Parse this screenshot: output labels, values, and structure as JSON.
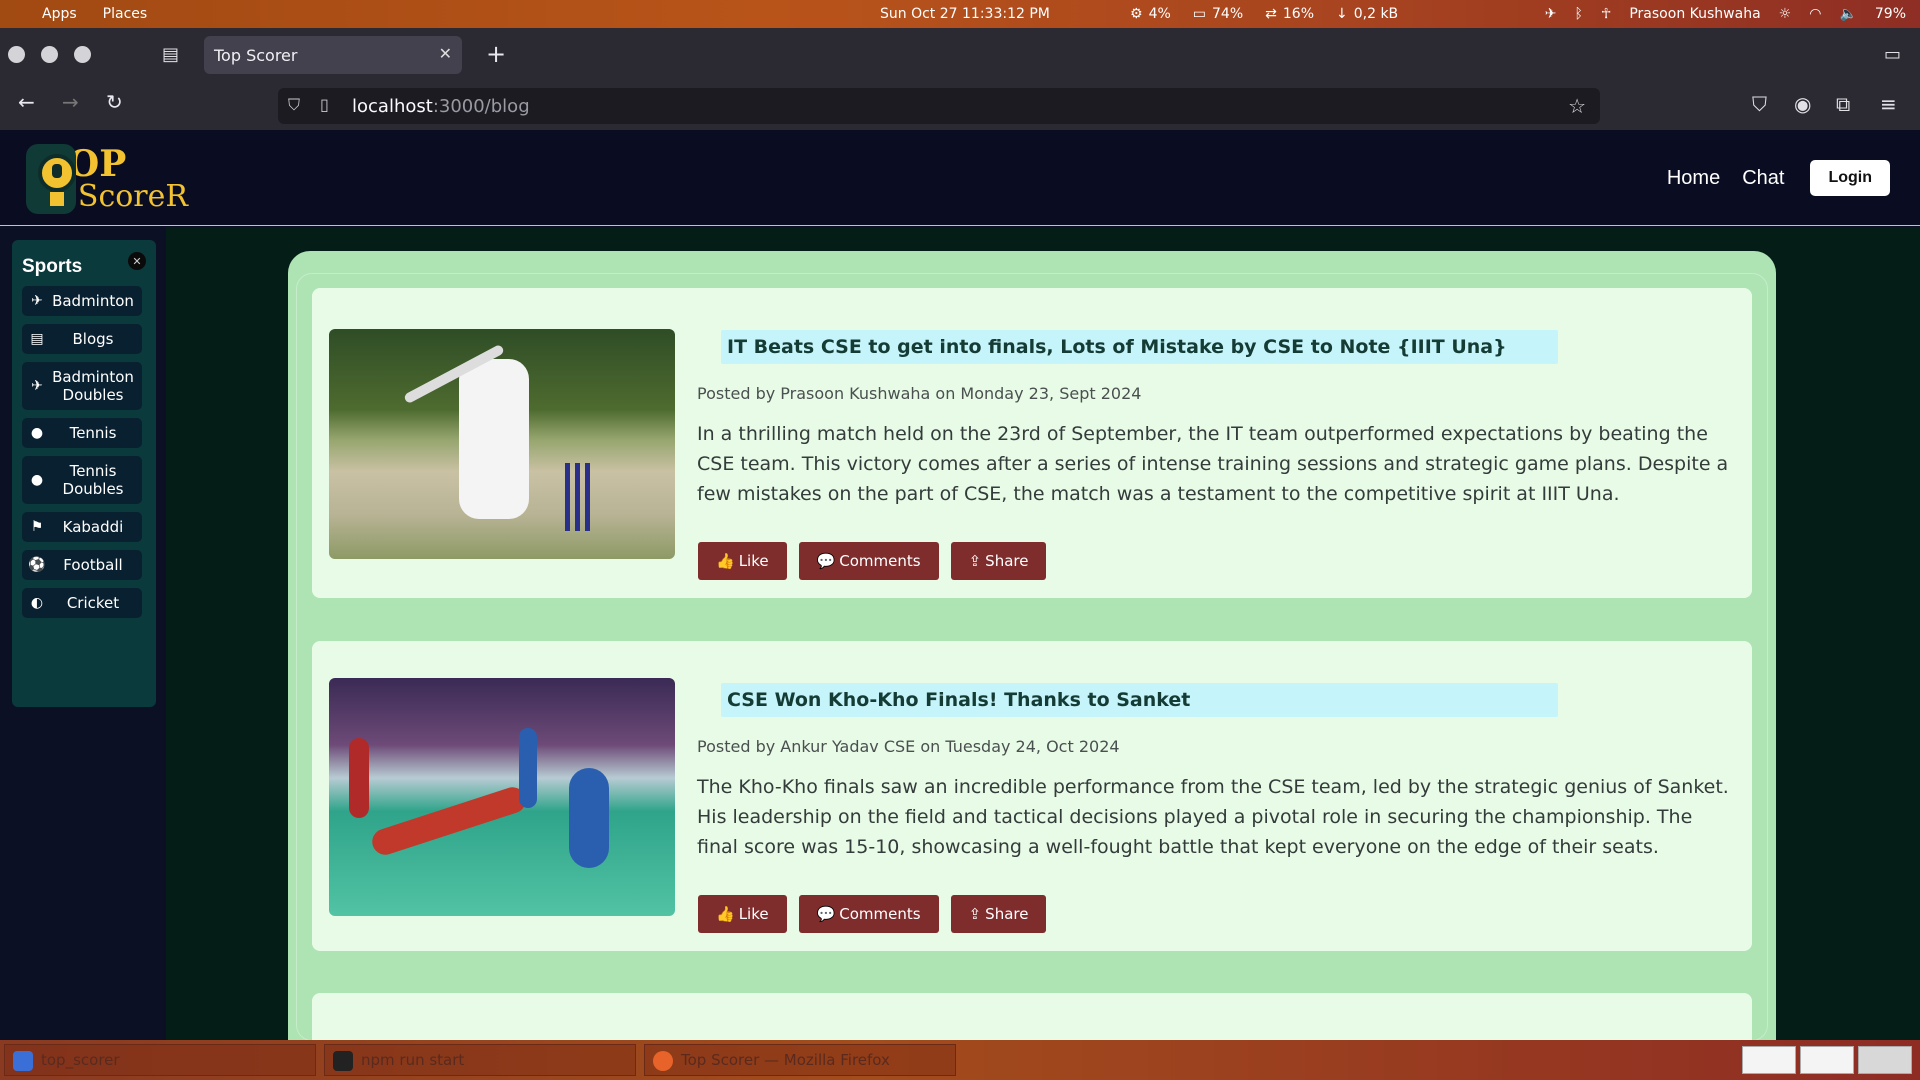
{
  "os": {
    "menu": [
      "Apps",
      "Places"
    ],
    "clock": "Sun Oct 27  11:33:12 PM",
    "stats": [
      {
        "icon": "cpu-icon",
        "value": "4%"
      },
      {
        "icon": "memory-icon",
        "value": "74%"
      },
      {
        "icon": "swap-icon",
        "value": "16%"
      },
      {
        "icon": "download-icon",
        "value": "0,2 kB"
      }
    ],
    "user": "Prasoon Kushwaha",
    "battery": "79%"
  },
  "browser": {
    "tab_title": "Top Scorer",
    "url_host": "localhost",
    "url_rest": ":3000/blog"
  },
  "site": {
    "logo_top": "OP",
    "logo_bottom": "ScoreR",
    "nav": {
      "home": "Home",
      "chat": "Chat",
      "login": "Login"
    }
  },
  "sidebar": {
    "title": "Sports",
    "items": [
      {
        "label": "Badminton",
        "icon": "shuttlecock-icon"
      },
      {
        "label": "Blogs",
        "icon": "newspaper-icon"
      },
      {
        "label": "Badminton Doubles",
        "icon": "shuttlecock-icon"
      },
      {
        "label": "Tennis",
        "icon": "tennis-icon"
      },
      {
        "label": "Tennis Doubles",
        "icon": "tennis-icon"
      },
      {
        "label": "Kabaddi",
        "icon": "running-icon"
      },
      {
        "label": "Football",
        "icon": "football-icon"
      },
      {
        "label": "Cricket",
        "icon": "cricket-ball-icon"
      }
    ]
  },
  "posts": [
    {
      "title": "IT Beats CSE to get into finals, Lots of Mistake by CSE to Note {IIIT Una}",
      "meta": "Posted by Prasoon Kushwaha on Monday 23, Sept 2024",
      "excerpt": "In a thrilling match held on the 23rd of September, the IT team outperformed expectations by beating the CSE team. This victory comes after a series of intense training sessions and strategic game plans. Despite a few mistakes on the part of CSE, the match was a testament to the competitive spirit at IIIT Una.",
      "actions": {
        "like": "Like",
        "comments": "Comments",
        "share": "Share"
      }
    },
    {
      "title": "CSE Won Kho-Kho Finals! Thanks to Sanket",
      "meta": "Posted by Ankur Yadav CSE on Tuesday 24, Oct 2024",
      "excerpt": "The Kho-Kho finals saw an incredible performance from the CSE team, led by the strategic genius of Sanket. His leadership on the field and tactical decisions played a pivotal role in securing the championship. The final score was 15-10, showcasing a well-fought battle that kept everyone on the edge of their seats.",
      "actions": {
        "like": "Like",
        "comments": "Comments",
        "share": "Share"
      }
    }
  ],
  "taskbar": [
    {
      "label": "top_scorer",
      "icon": "file-manager-icon"
    },
    {
      "label": "npm run start",
      "icon": "terminal-icon"
    },
    {
      "label": "Top Scorer — Mozilla Firefox",
      "icon": "firefox-icon"
    }
  ]
}
